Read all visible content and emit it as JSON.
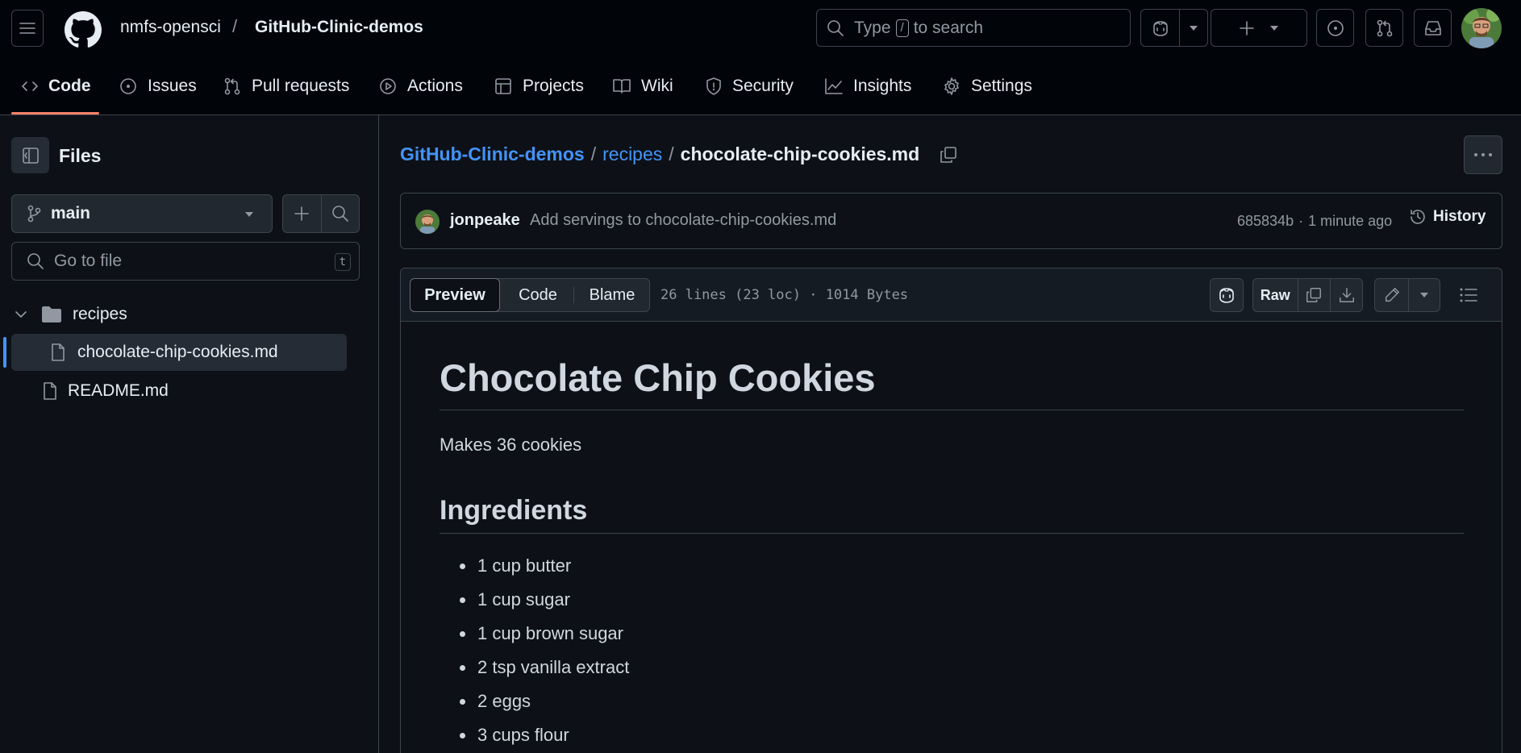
{
  "header": {
    "owner": "nmfs-opensci",
    "separator": "/",
    "repo": "GitHub-Clinic-demos",
    "search": {
      "prefix": "Type",
      "key": "/",
      "suffix": "to search"
    }
  },
  "repo_nav": {
    "tabs": [
      {
        "label": "Code",
        "icon": "code-icon",
        "active": true
      },
      {
        "label": "Issues",
        "icon": "issue-icon"
      },
      {
        "label": "Pull requests",
        "icon": "pull-request-icon"
      },
      {
        "label": "Actions",
        "icon": "play-icon"
      },
      {
        "label": "Projects",
        "icon": "table-icon"
      },
      {
        "label": "Wiki",
        "icon": "book-icon"
      },
      {
        "label": "Security",
        "icon": "shield-icon"
      },
      {
        "label": "Insights",
        "icon": "graph-icon"
      },
      {
        "label": "Settings",
        "icon": "gear-icon"
      }
    ]
  },
  "sidebar": {
    "title": "Files",
    "branch": "main",
    "goto_placeholder": "Go to file",
    "goto_shortcut": "t",
    "tree": [
      {
        "name": "recipes",
        "type": "folder",
        "expanded": true
      },
      {
        "name": "chocolate-chip-cookies.md",
        "type": "file",
        "selected": true
      },
      {
        "name": "README.md",
        "type": "file"
      }
    ]
  },
  "breadcrumb": {
    "root": "GitHub-Clinic-demos",
    "folder": "recipes",
    "file": "chocolate-chip-cookies.md",
    "sep": "/"
  },
  "commit": {
    "author": "jonpeake",
    "message": "Add servings to chocolate-chip-cookies.md",
    "sha": "685834b",
    "dot": "·",
    "time": "1 minute ago",
    "history_label": "History"
  },
  "file_header": {
    "tabs": [
      "Preview",
      "Code",
      "Blame"
    ],
    "meta": "26 lines (23 loc) · 1014 Bytes",
    "raw_label": "Raw"
  },
  "markdown": {
    "h1": "Chocolate Chip Cookies",
    "intro": "Makes 36 cookies",
    "h2": "Ingredients",
    "items": [
      "1 cup butter",
      "1 cup sugar",
      "1 cup brown sugar",
      "2 tsp vanilla extract",
      "2 eggs",
      "3 cups flour"
    ]
  },
  "colors": {
    "accent_link": "#4493f8",
    "tab_underline": "#f78166",
    "background": "#0d1117",
    "header_bg": "#010409"
  }
}
